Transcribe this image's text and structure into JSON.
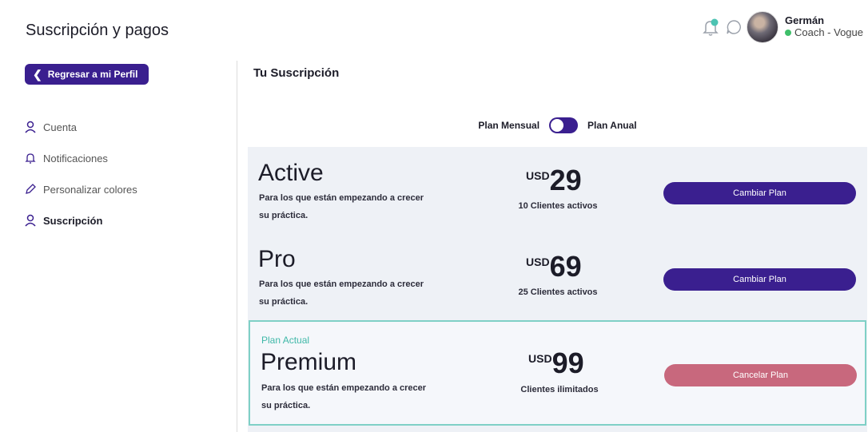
{
  "header": {
    "title": "Suscripción y pagos",
    "user": {
      "name": "Germán",
      "role": "Coach - Vogue",
      "status_color": "#3fbf6a"
    },
    "icons": [
      "bell-icon",
      "chat-icon"
    ]
  },
  "sidebar": {
    "back_label": "Regresar a mi Perfil",
    "items": [
      {
        "label": "Cuenta",
        "icon": "user-icon"
      },
      {
        "label": "Notificaciones",
        "icon": "bell-icon"
      },
      {
        "label": "Personalizar colores",
        "icon": "pencil-icon"
      },
      {
        "label": "Suscripción",
        "icon": "user-icon",
        "active": true
      }
    ]
  },
  "main": {
    "title": "Tu Suscripción",
    "billing": {
      "monthly": "Plan Mensual",
      "annual": "Plan Anual"
    },
    "plans": [
      {
        "name": "Active",
        "desc_line1": "Para los que están empezando a crecer",
        "desc_line2": "su práctica.",
        "currency": "USD",
        "price": "29",
        "clients": "10 Clientes activos",
        "button": "Cambiar Plan"
      },
      {
        "name": "Pro",
        "desc_line1": "Para los que están empezando a crecer",
        "desc_line2": "su práctica.",
        "currency": "USD",
        "price": "69",
        "clients": "25 Clientes activos",
        "button": "Cambiar Plan"
      },
      {
        "tag": "Plan Actual",
        "name": "Premium",
        "desc_line1": "Para los que están empezando a crecer",
        "desc_line2": "su práctica.",
        "currency": "USD",
        "price": "99",
        "clients": "Clientes ilimitados",
        "button": "Cancelar Plan"
      }
    ]
  },
  "colors": {
    "primary": "#3a1f8f",
    "cancel": "#c8687d",
    "current_border": "#7fd0c6",
    "tag": "#3fb8a8",
    "plans_bg": "#eef1f6"
  }
}
